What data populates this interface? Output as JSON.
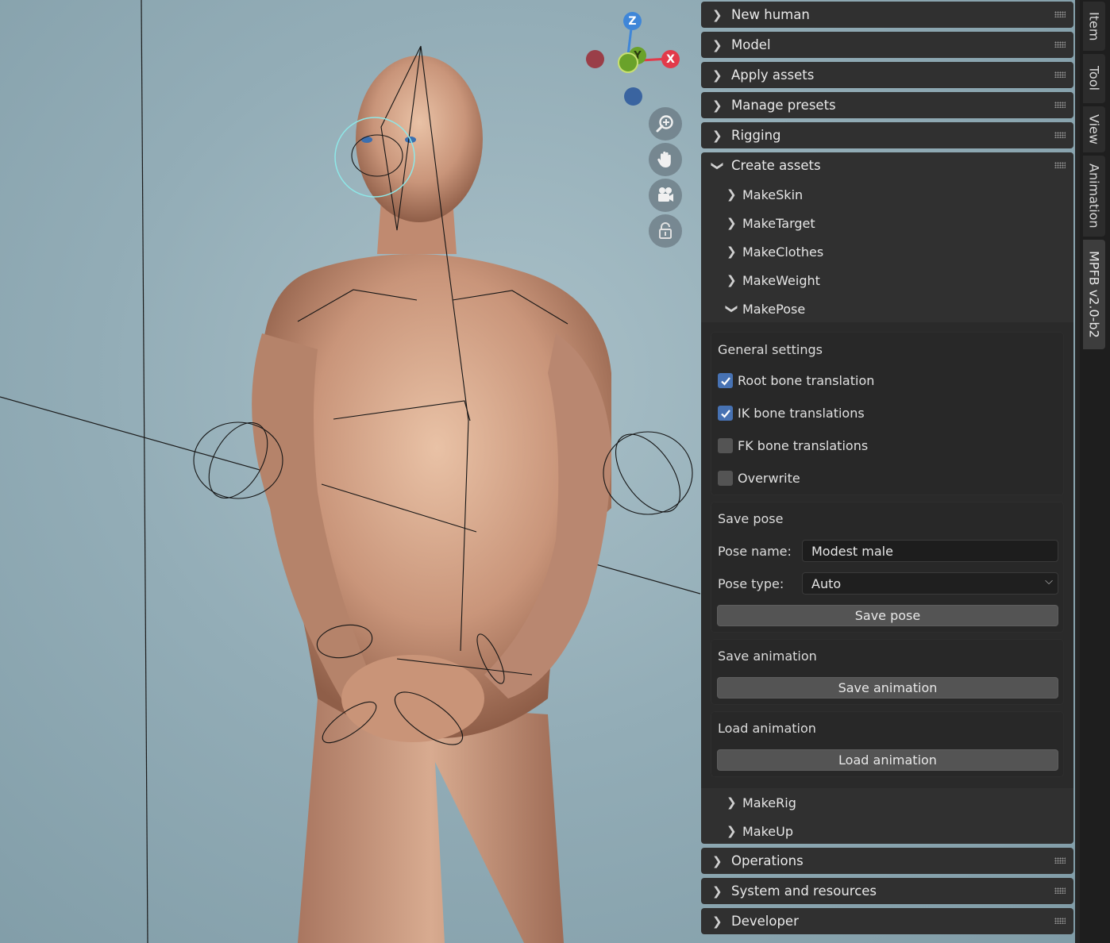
{
  "viewport": {
    "gizmo": {
      "z": "Z",
      "y": "Y",
      "x": "X"
    },
    "nav_buttons": [
      "zoom-icon",
      "hand-pan-icon",
      "camera-icon",
      "lock-icon"
    ],
    "colors": {
      "x_axis": "#e23a4a",
      "y_axis": "#6aa22a",
      "z_axis": "#3f86d8",
      "neg_x": "#9a3e48",
      "neg_z": "#3a64a0"
    }
  },
  "panels": {
    "new_human": "New human",
    "model": "Model",
    "apply_assets": "Apply assets",
    "manage_presets": "Manage presets",
    "rigging": "Rigging",
    "create_assets": "Create assets",
    "operations": "Operations",
    "system_and_resources": "System and resources",
    "developer": "Developer"
  },
  "create_assets": {
    "items": {
      "make_skin": "MakeSkin",
      "make_target": "MakeTarget",
      "make_clothes": "MakeClothes",
      "make_weight": "MakeWeight",
      "make_pose": "MakePose",
      "make_rig": "MakeRig",
      "make_up": "MakeUp"
    },
    "make_pose": {
      "general_settings": {
        "title": "General settings",
        "root_bone_translation": {
          "label": "Root bone translation",
          "checked": true
        },
        "ik_bone_translations": {
          "label": "IK bone translations",
          "checked": true
        },
        "fk_bone_translations": {
          "label": "FK bone translations",
          "checked": false
        },
        "overwrite": {
          "label": "Overwrite",
          "checked": false
        }
      },
      "save_pose": {
        "title": "Save pose",
        "pose_name_label": "Pose name:",
        "pose_name_value": "Modest male",
        "pose_type_label": "Pose type:",
        "pose_type_value": "Auto",
        "button": "Save pose"
      },
      "save_animation": {
        "title": "Save animation",
        "button": "Save animation"
      },
      "load_animation": {
        "title": "Load animation",
        "button": "Load animation"
      }
    }
  },
  "tabs": {
    "item": "Item",
    "tool": "Tool",
    "view": "View",
    "animation": "Animation",
    "mpfb": "MPFB v2.0-b2",
    "active": "MPFB v2.0-b2"
  }
}
